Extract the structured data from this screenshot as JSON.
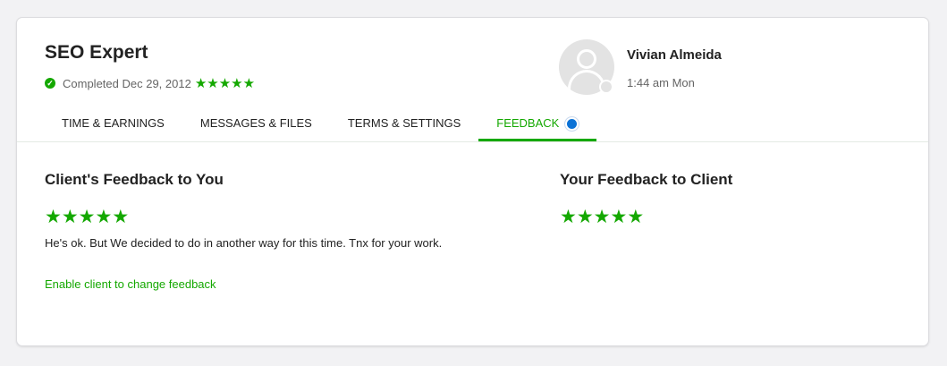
{
  "contract": {
    "title": "SEO Expert",
    "status_text": "Completed Dec 29, 2012",
    "rating": 5
  },
  "freelancer": {
    "name": "Vivian Almeida",
    "local_time": "1:44 am Mon"
  },
  "tabs": [
    {
      "label": "TIME & EARNINGS",
      "active": false
    },
    {
      "label": "MESSAGES & FILES",
      "active": false
    },
    {
      "label": "TERMS & SETTINGS",
      "active": false
    },
    {
      "label": "FEEDBACK",
      "active": true,
      "has_notification": true
    }
  ],
  "client_feedback": {
    "heading": "Client's Feedback to You",
    "rating": 5,
    "comment": "He's ok. But We decided to do in another way for this time. Tnx for your work.",
    "link_label": "Enable client to change feedback"
  },
  "your_feedback": {
    "heading": "Your Feedback to Client",
    "rating": 5
  },
  "colors": {
    "accent": "#14a800",
    "notification": "#0b72d6",
    "background": "#f2f2f4"
  }
}
